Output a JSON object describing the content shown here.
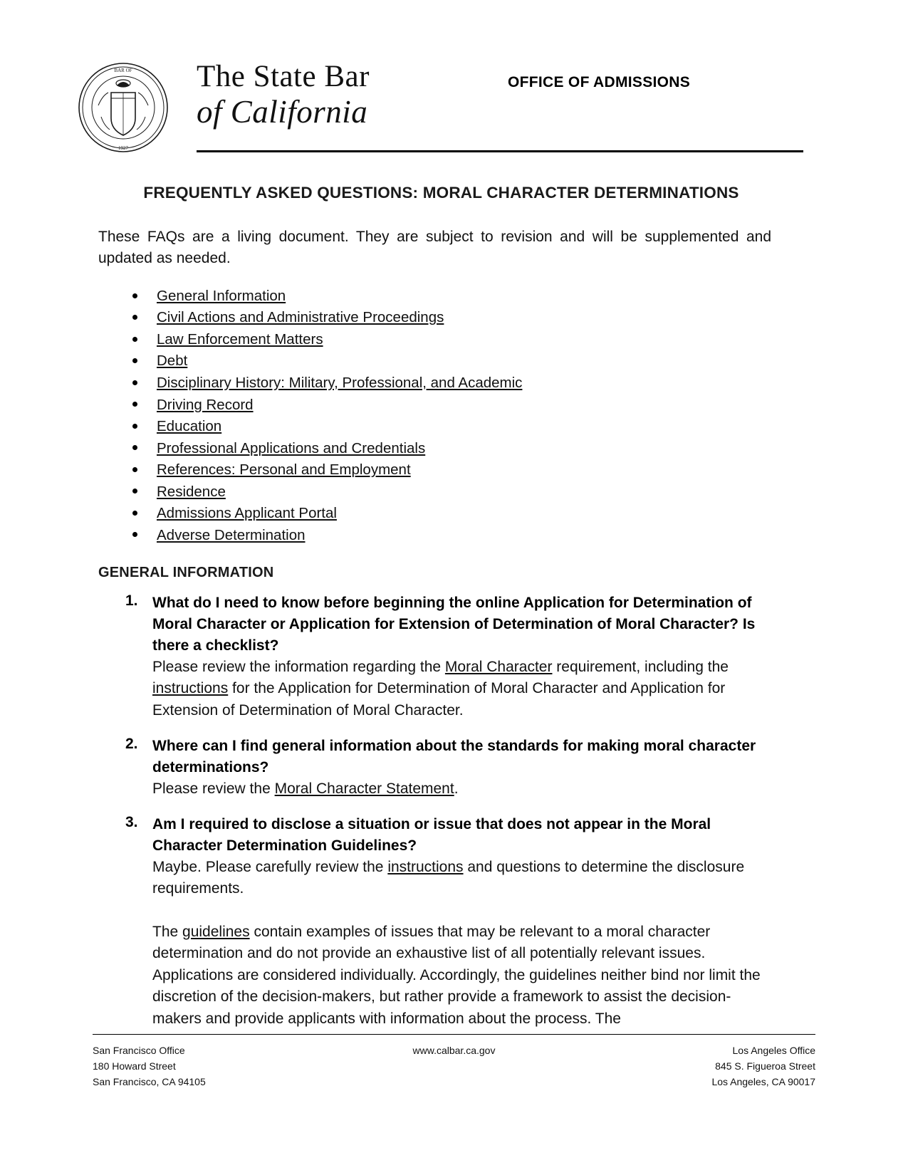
{
  "masthead": {
    "seal_icon": "state-bar-seal-icon",
    "brand_line1": "The State Bar",
    "brand_line2": "of California",
    "office_title": "OFFICE OF ADMISSIONS"
  },
  "document": {
    "title": "FREQUENTLY ASKED QUESTIONS: MORAL CHARACTER DETERMINATIONS",
    "intro": "These FAQs are a living document. They are subject to revision and will be supplemented and updated as needed."
  },
  "toc": [
    {
      "label": "General Information"
    },
    {
      "label": "Civil Actions and Administrative Proceedings"
    },
    {
      "label": "Law Enforcement Matters"
    },
    {
      "label": "Debt"
    },
    {
      "label": "Disciplinary History: Military, Professional, and Academic"
    },
    {
      "label": "Driving Record"
    },
    {
      "label": "Education"
    },
    {
      "label": "Professional Applications and Credentials"
    },
    {
      "label": "References: Personal and Employment"
    },
    {
      "label": "Residence"
    },
    {
      "label": "Admissions Applicant Portal"
    },
    {
      "label": "Adverse Determination"
    }
  ],
  "sections": {
    "general_information_heading": "GENERAL INFORMATION"
  },
  "faq": [
    {
      "number": "1.",
      "question": "What do I need to know before beginning the online Application for Determination of Moral Character or Application for Extension of Determination of Moral Character? Is there a checklist?",
      "answer_parts": [
        {
          "type": "text",
          "value": "Please review the information regarding the "
        },
        {
          "type": "link",
          "value": "Moral Character"
        },
        {
          "type": "text",
          "value": " requirement, including the "
        },
        {
          "type": "link",
          "value": "instructions"
        },
        {
          "type": "text",
          "value": " for the Application for Determination of Moral Character and Application for Extension of Determination of Moral Character."
        }
      ]
    },
    {
      "number": "2.",
      "question": "Where can I find general information about the standards for making moral character determinations?",
      "answer_parts": [
        {
          "type": "text",
          "value": "Please review the "
        },
        {
          "type": "link",
          "value": "Moral Character Statement"
        },
        {
          "type": "text",
          "value": "."
        }
      ]
    },
    {
      "number": "3.",
      "question": "Am I required to disclose a situation or issue that does not appear in the Moral Character Determination Guidelines?",
      "answer_parts": [
        {
          "type": "text",
          "value": "Maybe. Please carefully review the "
        },
        {
          "type": "link",
          "value": "instructions"
        },
        {
          "type": "text",
          "value": " and questions to determine the disclosure requirements."
        }
      ],
      "answer_parts_2": [
        {
          "type": "text",
          "value": "The "
        },
        {
          "type": "link",
          "value": "guidelines"
        },
        {
          "type": "text",
          "value": " contain examples of issues that may be relevant to a moral character determination and do not provide an exhaustive list of all potentially relevant issues. Applications are considered individually. Accordingly, the guidelines neither bind nor limit the discretion of the decision-makers, but rather provide a framework to assist the decision-makers and provide applicants with information about the process. The"
        }
      ]
    }
  ],
  "footer": {
    "left": {
      "line1": "San Francisco Office",
      "line2": "180 Howard Street",
      "line3": "San Francisco, CA 94105"
    },
    "center": {
      "website": "www.calbar.ca.gov"
    },
    "right": {
      "line1": "Los Angeles Office",
      "line2": "845 S. Figueroa Street",
      "line3": "Los Angeles, CA 90017"
    }
  }
}
